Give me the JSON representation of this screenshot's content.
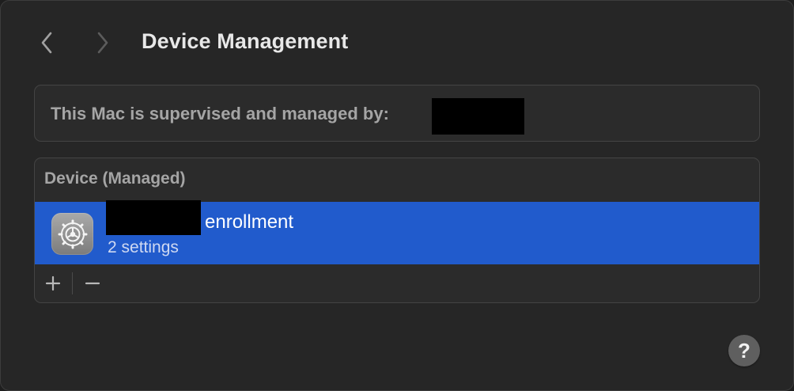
{
  "header": {
    "title": "Device Management",
    "back_icon": "chevron-left-icon",
    "forward_icon": "chevron-right-icon"
  },
  "supervision": {
    "text": "This Mac is supervised and managed by:"
  },
  "device_panel": {
    "header": "Device (Managed)",
    "profiles": [
      {
        "name": "enrollment",
        "detail": "2 settings",
        "icon": "gear-icon",
        "selected": true
      }
    ],
    "add_label": "+",
    "remove_label": "−"
  },
  "help": {
    "label": "?"
  },
  "colors": {
    "selection": "#215bcc",
    "window_bg": "#262626",
    "panel_bg": "#2b2b2b"
  }
}
